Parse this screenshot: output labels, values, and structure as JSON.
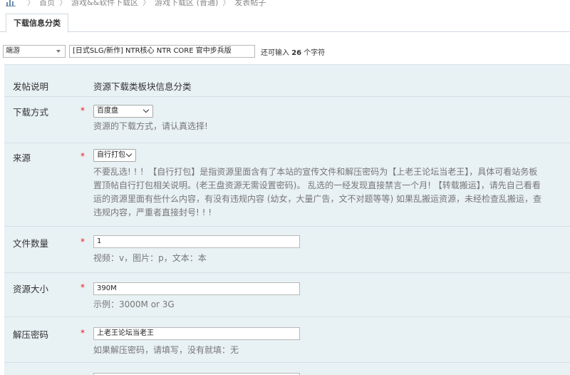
{
  "breadcrumb": {
    "items": [
      "首页",
      "游戏&&软件下载区",
      "游戏下载区 (普通)",
      "发表帖子"
    ]
  },
  "tabs": [
    {
      "label": "下载信息分类"
    }
  ],
  "post": {
    "type_value": "端游",
    "subject_value": "[日式SLG/新作] NTR核心 NTR CORE 官中步兵版",
    "remain_prefix": "还可输入",
    "remain_count": "26",
    "remain_suffix": "个字符"
  },
  "form": {
    "intro": {
      "label": "发帖说明",
      "value": "资源下载类板块信息分类"
    },
    "download_method": {
      "label": "下载方式",
      "required": "*",
      "value": "百度盘",
      "hint": "资源的下载方式，请认真选择!"
    },
    "source": {
      "label": "来源",
      "required": "*",
      "value": "自行打包",
      "hint_lines": [
        "不要乱选! ! ！【自行打包】是指资源里面含有了本站的宣传文件和解压密码为【上老王论坛当老王】，具体可看站务板",
        "置顶帖自行打包相关说明。(老王盘资源无需设置密码)。 乱选的一经发现直接禁言一个月! 【转载搬运】，请先自己看看",
        "运的资源里面有些什么内容，有没有违规内容 (幼女，大量广告，文不对题等等) 如果乱搬运资源，未经检查乱搬运，查",
        "违规内容，严重者直接封号! ! !"
      ]
    },
    "file_count": {
      "label": "文件数量",
      "required": "*",
      "value": "1",
      "hint": "视频：v，图片：p，文本：本"
    },
    "size": {
      "label": "资源大小",
      "required": "*",
      "value": "390M",
      "hint": "示例：3000M or 3G"
    },
    "password": {
      "label": "解压密码",
      "required": "*",
      "value": "上老王论坛当老王",
      "hint": "如果解压密码，请填写，没有就填：无"
    }
  }
}
